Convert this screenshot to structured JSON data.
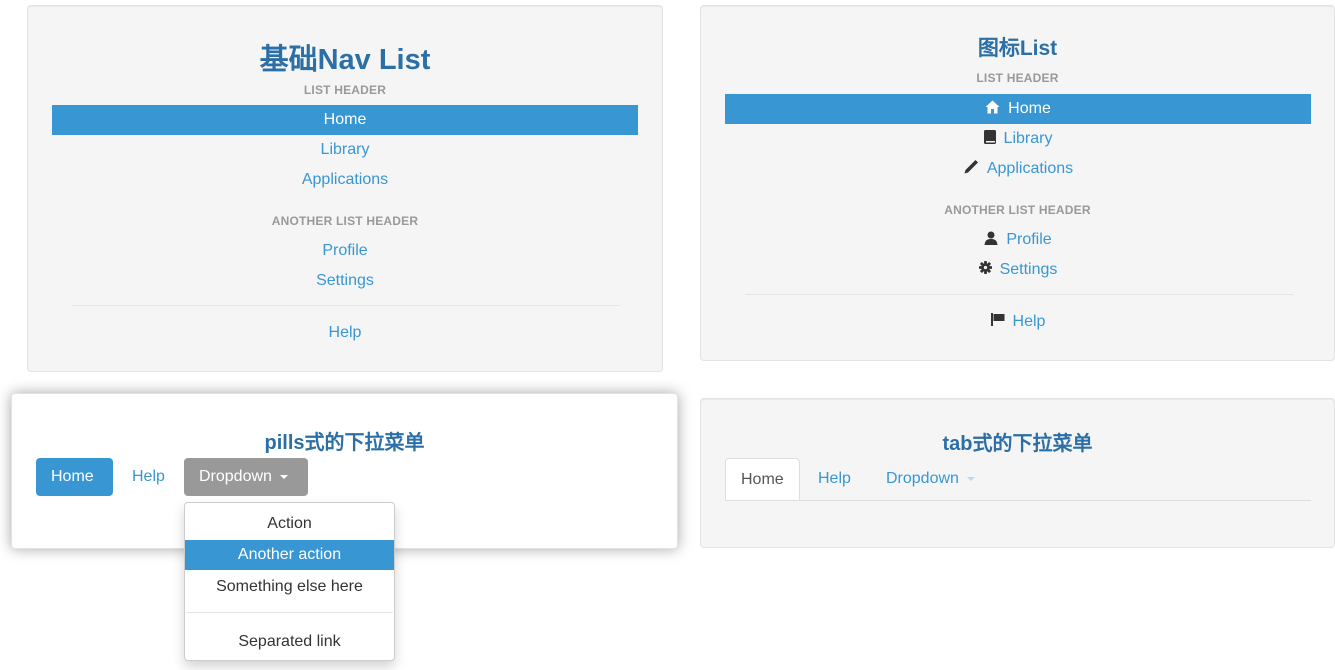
{
  "colors": {
    "accent": "#3897d3",
    "title": "#2c6fa6",
    "header": "#999999",
    "dropdown_gray": "#999999"
  },
  "basic_nav": {
    "title": "基础Nav List",
    "header1": "LIST HEADER",
    "items1": [
      "Home",
      "Library",
      "Applications"
    ],
    "header2": "ANOTHER LIST HEADER",
    "items2": [
      "Profile",
      "Settings"
    ],
    "help": "Help",
    "active": "Home"
  },
  "icon_nav": {
    "title": "图标List",
    "header1": "LIST HEADER",
    "items1": [
      {
        "label": "Home",
        "icon": "home-icon"
      },
      {
        "label": "Library",
        "icon": "book-icon"
      },
      {
        "label": "Applications",
        "icon": "pencil-icon"
      }
    ],
    "header2": "ANOTHER LIST HEADER",
    "items2": [
      {
        "label": "Profile",
        "icon": "user-icon"
      },
      {
        "label": "Settings",
        "icon": "cog-icon"
      }
    ],
    "help": {
      "label": "Help",
      "icon": "flag-icon"
    },
    "active": "Home"
  },
  "pills": {
    "title": "pills式的下拉菜单",
    "items": [
      "Home",
      "Help",
      "Dropdown"
    ],
    "dropdown_items": [
      "Action",
      "Another action",
      "Something else here",
      "Separated link"
    ],
    "active_dropdown_item": "Another action"
  },
  "tabs": {
    "title": "tab式的下拉菜单",
    "items": [
      "Home",
      "Help",
      "Dropdown"
    ]
  }
}
